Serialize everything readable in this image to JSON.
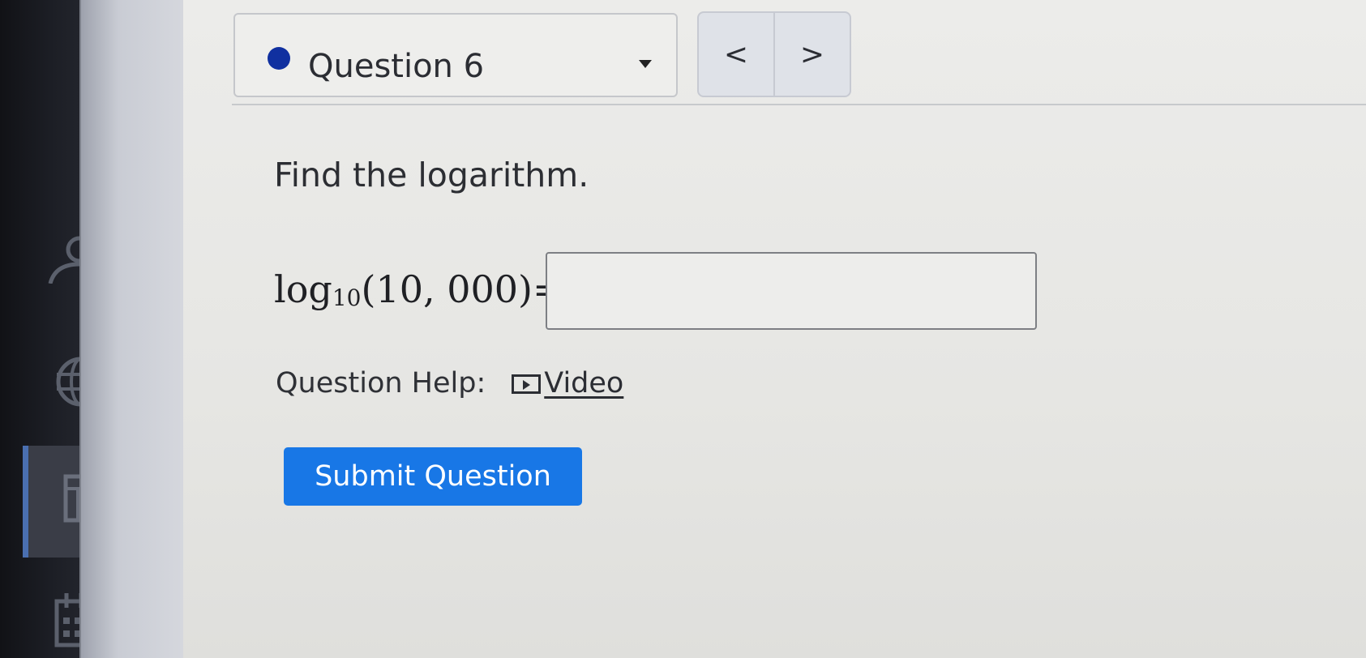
{
  "question_nav": {
    "selected_question": "Question 6",
    "prev_symbol": "<",
    "next_symbol": ">"
  },
  "question": {
    "prompt": "Find the logarithm.",
    "formula": {
      "func": "log",
      "base": "10",
      "argument": "(10, 000)=",
      "answer_value": ""
    },
    "help_label": "Question Help:",
    "help_link_label": "Video",
    "submit_label": "Submit Question"
  },
  "colors": {
    "submit_button": "#1877e6",
    "question_status_dot": "#1030a0"
  },
  "icons": [
    "user-icon",
    "globe-icon",
    "calculator-icon",
    "calendar-icon",
    "video-icon",
    "dropdown-caret-icon"
  ]
}
